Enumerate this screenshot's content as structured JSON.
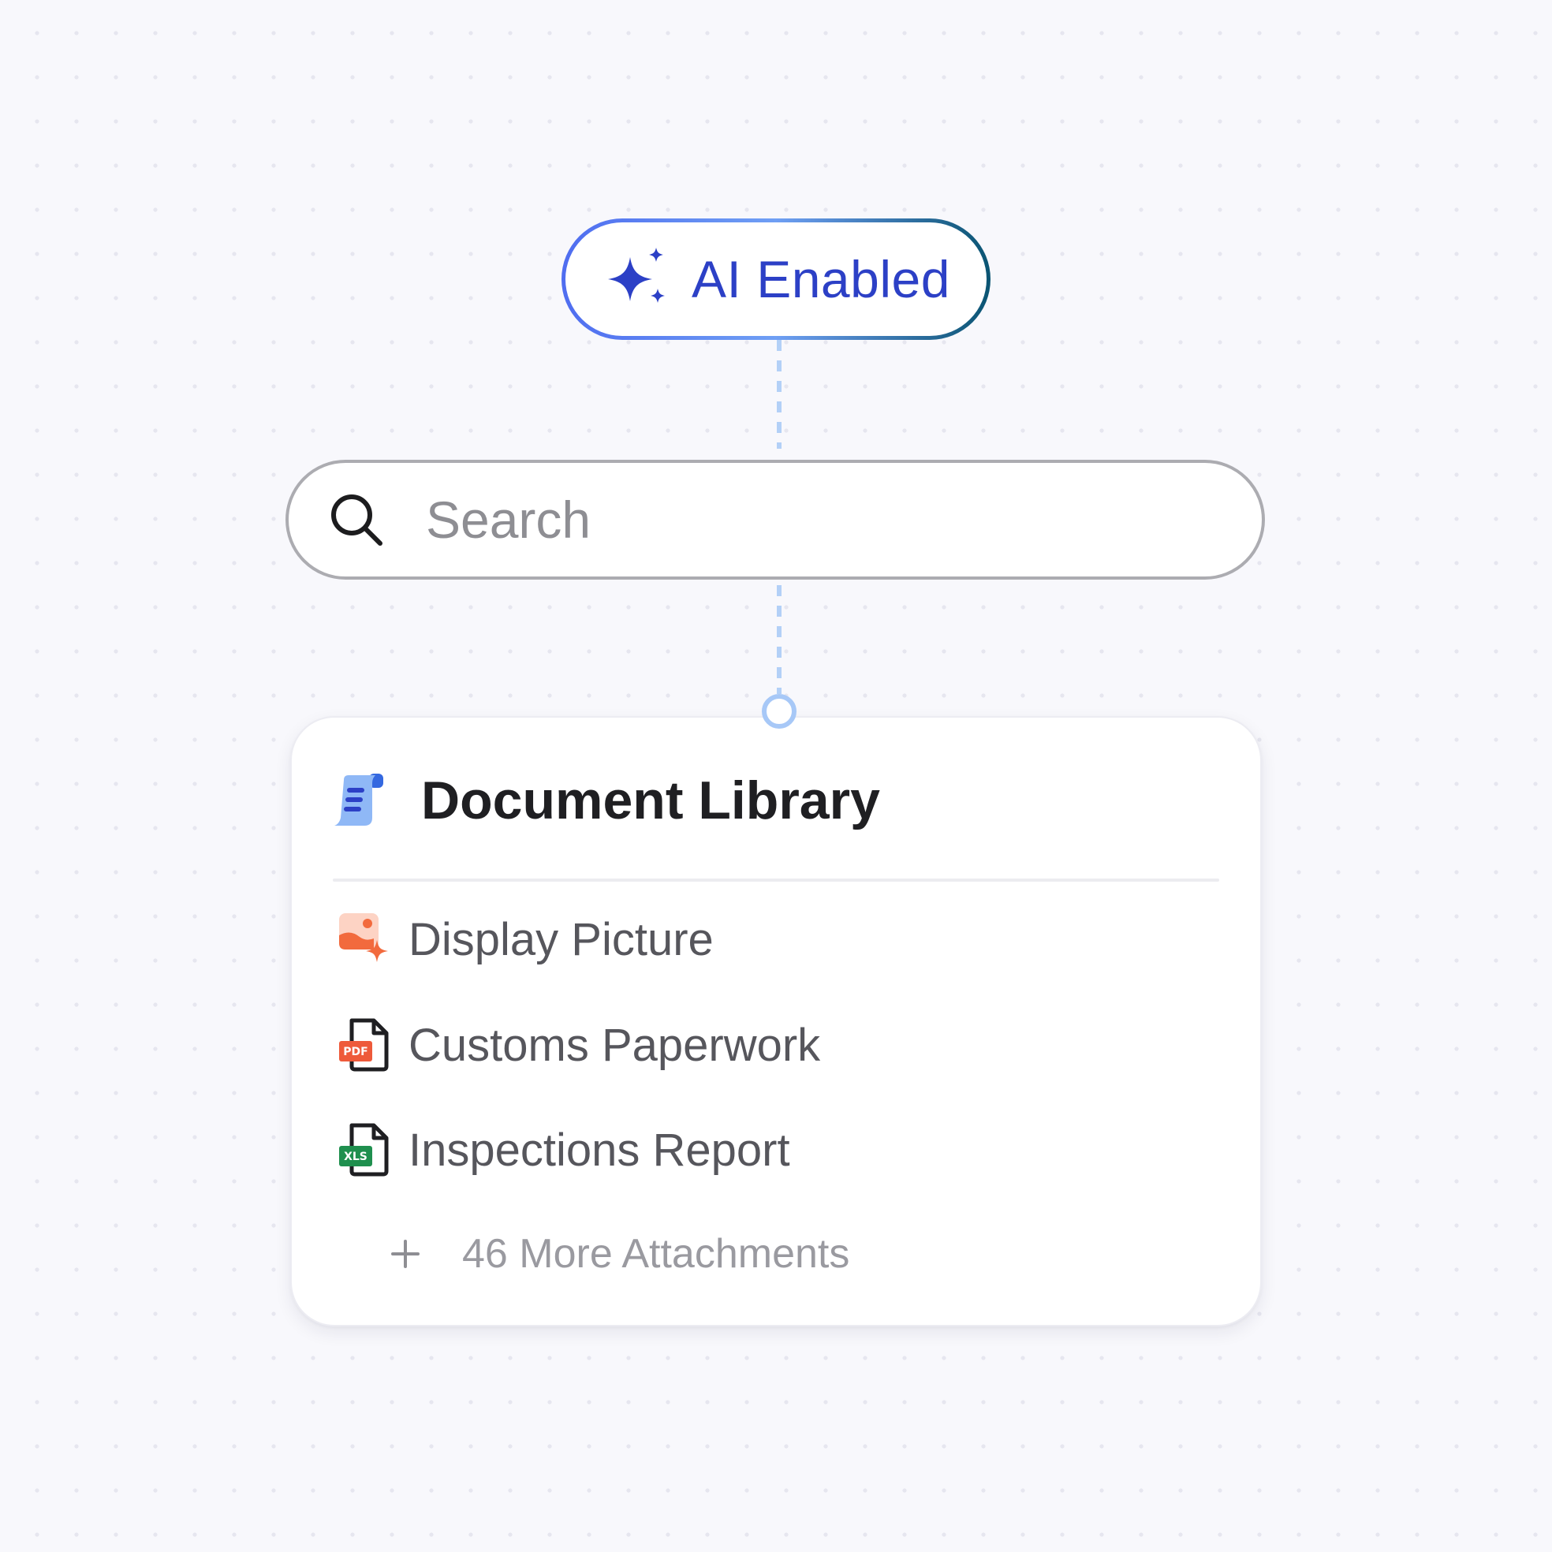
{
  "ai_badge": {
    "label": "AI Enabled",
    "icon": "sparkle-icon",
    "gradient_colors": [
      "#4f6df0",
      "#6f9ff4",
      "#0a5472"
    ],
    "text_color": "#2c40c6"
  },
  "search": {
    "placeholder": "Search",
    "value": "",
    "icon": "search-icon"
  },
  "library": {
    "title": "Document Library",
    "icon": "document-scroll-icon",
    "items": [
      {
        "label": "Display Picture",
        "icon": "image-sparkle-icon",
        "accent": "#f26a3d"
      },
      {
        "label": "Customs Paperwork",
        "icon": "pdf-file-icon",
        "badge": "PDF",
        "accent": "#ee5a3a"
      },
      {
        "label": "Inspections Report",
        "icon": "xls-file-icon",
        "badge": "XLS",
        "accent": "#1f8f4e"
      }
    ],
    "more": {
      "label": "46 More Attachments",
      "icon": "plus-icon"
    }
  },
  "connector_color": "#b3d0f7"
}
